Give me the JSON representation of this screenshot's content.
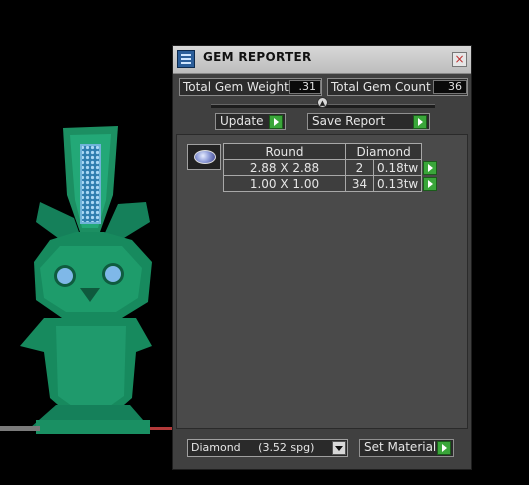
{
  "window": {
    "title": "GEM REPORTER",
    "close_glyph": "×"
  },
  "stats": {
    "total_weight_label": "Total Gem Weight",
    "total_weight_value": ".31",
    "total_count_label": "Total Gem Count",
    "total_count_value": "36"
  },
  "toolbar": {
    "update_label": "Update",
    "save_report_label": "Save Report"
  },
  "table": {
    "shape_header": "Round",
    "material_header": "Diamond",
    "rows": [
      {
        "size": "2.88 X 2.88",
        "count": "2",
        "weight": "0.18tw"
      },
      {
        "size": "1.00 X 1.00",
        "count": "34",
        "weight": "0.13tw"
      }
    ]
  },
  "footer": {
    "material_value": "Diamond     (3.52 spg)",
    "set_material_label": "Set Material"
  },
  "colors": {
    "model_green": "#1f9a6c",
    "gem_blue": "#7fb8e8",
    "go_green": "#3aa63a"
  }
}
